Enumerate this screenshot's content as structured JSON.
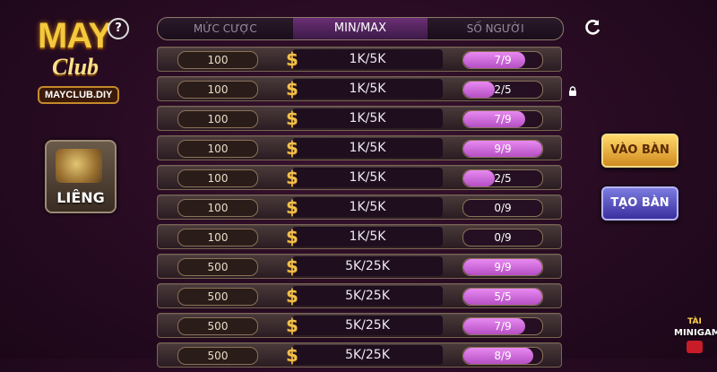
{
  "logo": {
    "brand": "MAY",
    "brand_sub": "Club",
    "site": "MAYCLUB.DIY"
  },
  "help": {
    "label": "?"
  },
  "game": {
    "label": "LIÊNG"
  },
  "header": {
    "bet": "MỨC CƯỢC",
    "minmax": "MIN/MAX",
    "players": "SỐ NGƯỜI"
  },
  "icons": {
    "refresh": "refresh-icon",
    "lock": "lock-icon",
    "currency": "dollar-icon"
  },
  "rows": [
    {
      "bet": "100",
      "minmax": "1K/5K",
      "players": "7/9",
      "fill": 0.78
    },
    {
      "bet": "100",
      "minmax": "1K/5K",
      "players": "2/5",
      "fill": 0.4
    },
    {
      "bet": "100",
      "minmax": "1K/5K",
      "players": "7/9",
      "fill": 0.78
    },
    {
      "bet": "100",
      "minmax": "1K/5K",
      "players": "9/9",
      "fill": 1.0
    },
    {
      "bet": "100",
      "minmax": "1K/5K",
      "players": "2/5",
      "fill": 0.4
    },
    {
      "bet": "100",
      "minmax": "1K/5K",
      "players": "0/9",
      "fill": 0.0
    },
    {
      "bet": "100",
      "minmax": "1K/5K",
      "players": "0/9",
      "fill": 0.0
    },
    {
      "bet": "500",
      "minmax": "5K/25K",
      "players": "9/9",
      "fill": 1.0
    },
    {
      "bet": "500",
      "minmax": "5K/25K",
      "players": "5/5",
      "fill": 1.0
    },
    {
      "bet": "500",
      "minmax": "5K/25K",
      "players": "7/9",
      "fill": 0.78
    },
    {
      "bet": "500",
      "minmax": "5K/25K",
      "players": "8/9",
      "fill": 0.89
    }
  ],
  "buttons": {
    "join": "VÀO BÀN",
    "create": "TẠO BÀN"
  },
  "minigame": {
    "title": "TÀI",
    "label": "MINIGAME"
  },
  "colors": {
    "gold": "#f2c04c",
    "slot_fill": "#d46fe0",
    "join": "#e0a030",
    "create": "#4e45c0"
  }
}
